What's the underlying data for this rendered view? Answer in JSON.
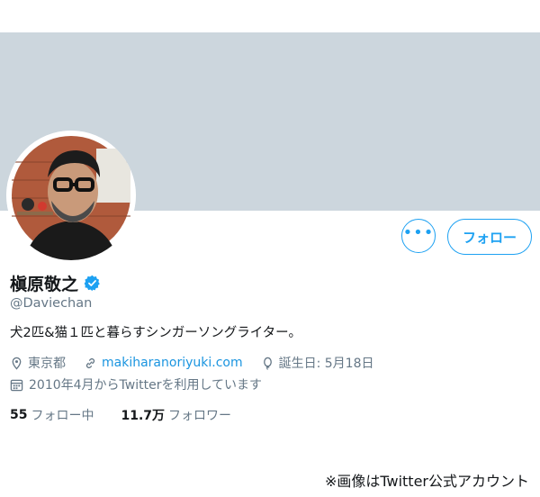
{
  "profile": {
    "display_name": "槇原敬之",
    "handle": "@Daviechan",
    "bio": "犬2匹&猫１匹と暮らすシンガーソングライター。",
    "location": "東京都",
    "website": "makiharanoriyuki.com",
    "birthday": "誕生日: 5月18日",
    "joined": "2010年4月からTwitterを利用しています",
    "verified": true
  },
  "actions": {
    "more_label": "•••",
    "follow_label": "フォロー"
  },
  "stats": {
    "following_count": "55",
    "following_label": "フォロー中",
    "followers_count": "11.7万",
    "followers_label": "フォロワー"
  },
  "caption": "※画像はTwitter公式アカウント",
  "colors": {
    "accent": "#1da1f2",
    "banner": "#ccd6dd",
    "secondary_text": "#657786",
    "link": "#1b95e0"
  },
  "icons": {
    "location": "location-pin-icon",
    "website": "link-icon",
    "birthday": "balloon-icon",
    "joined": "calendar-icon",
    "verified": "verified-badge-icon"
  }
}
